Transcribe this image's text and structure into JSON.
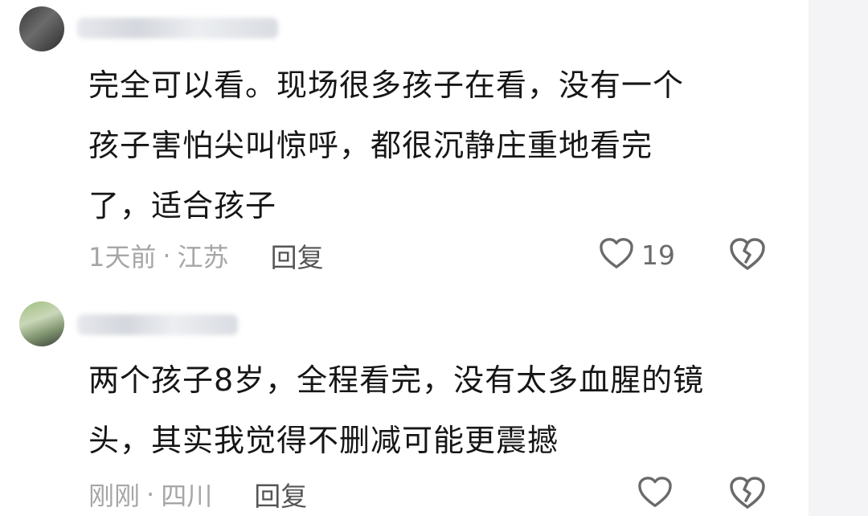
{
  "comments": [
    {
      "text": "完全可以看。现场很多孩子在看，没有一个\n孩子害怕尖叫惊呼，都很沉静庄重地看完\n了，适合孩子",
      "time": "1天前",
      "separator": "·",
      "location": "江苏",
      "reply_label": "回复",
      "like_count": "19",
      "like_icon": "heart-outline-icon",
      "dislike_icon": "broken-heart-icon"
    },
    {
      "text": "两个孩子8岁，全程看完，没有太多血腥的镜\n头，其实我觉得不删减可能更震撼",
      "time": "刚刚",
      "separator": "·",
      "location": "四川",
      "reply_label": "回复",
      "like_count": "",
      "like_icon": "heart-outline-icon",
      "dislike_icon": "broken-heart-icon"
    }
  ],
  "colors": {
    "text": "#161616",
    "meta": "#a6a6a6",
    "icon": "#6a6a6a",
    "background": "#ffffff",
    "side_strip": "#f4f4f6"
  }
}
